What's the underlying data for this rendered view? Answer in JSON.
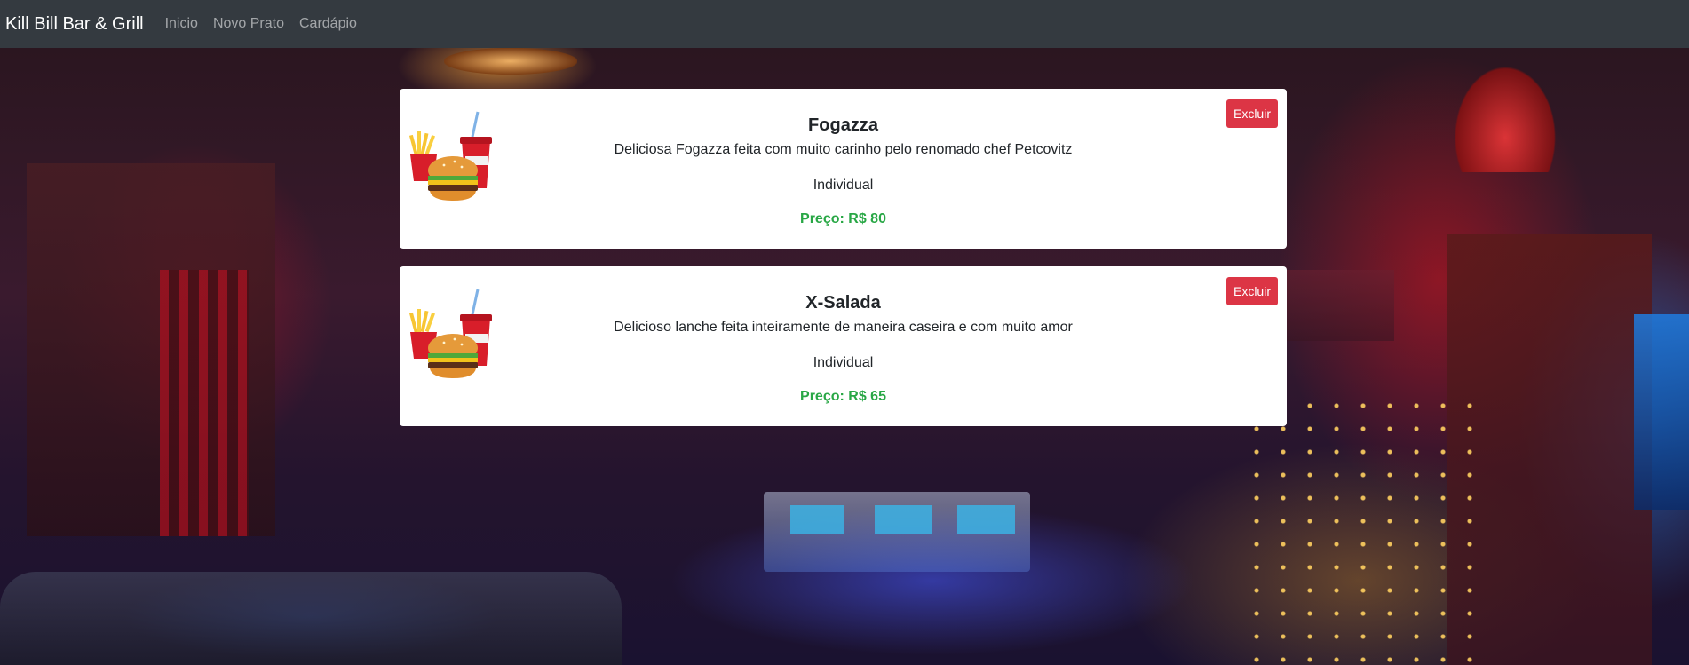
{
  "navbar": {
    "brand": "Kill Bill Bar & Grill",
    "links": [
      "Inicio",
      "Novo Prato",
      "Cardápio"
    ]
  },
  "colors": {
    "navbar_bg": "#343a40",
    "danger": "#dc3545",
    "price": "#28a745"
  },
  "dishes": [
    {
      "name": "Fogazza",
      "description": "Deliciosa Fogazza feita com muito carinho pelo renomado chef Petcovitz",
      "size": "Individual",
      "price": "Preço: R$ 80",
      "delete_label": "Excluir",
      "image_icon": "burger-combo-icon"
    },
    {
      "name": "X-Salada",
      "description": "Delicioso lanche feita inteiramente de maneira caseira e com muito amor",
      "size": "Individual",
      "price": "Preço: R$ 65",
      "delete_label": "Excluir",
      "image_icon": "burger-combo-icon"
    }
  ]
}
